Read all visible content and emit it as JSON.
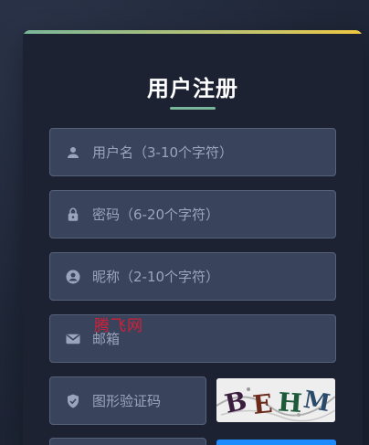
{
  "form": {
    "title": "用户注册",
    "fields": [
      {
        "name": "username",
        "icon": "user-icon",
        "placeholder": "用户名（3-10个字符）"
      },
      {
        "name": "password",
        "icon": "lock-icon",
        "placeholder": "密码（6-20个字符）"
      },
      {
        "name": "nickname",
        "icon": "account-circle-icon",
        "placeholder": "昵称（2-10个字符）"
      },
      {
        "name": "email",
        "icon": "mail-icon",
        "placeholder": "邮箱"
      },
      {
        "name": "captcha",
        "icon": "shield-check-icon",
        "placeholder": "图形验证码"
      }
    ],
    "captcha_text": "BEHM"
  },
  "watermark": "腾飞网",
  "colors": {
    "background": "#1f2738",
    "card": "#1c2232",
    "input": "#39435b",
    "accent": "#7ab69a",
    "gradient_end": "#f0c740",
    "primary_button": "#1c8bff",
    "watermark": "#d0203a"
  }
}
